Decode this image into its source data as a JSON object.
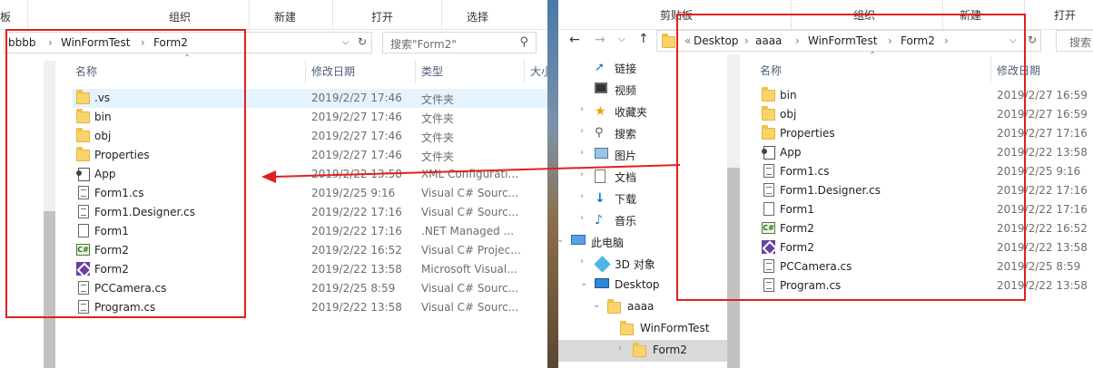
{
  "left_window": {
    "ribbon": {
      "clipboard_fragment": "板",
      "organize": "组织",
      "new": "新建",
      "open": "打开",
      "select": "选择"
    },
    "breadcrumb": [
      "bbbb",
      "WinFormTest",
      "Form2"
    ],
    "search_placeholder": "搜索\"Form2\"",
    "columns": {
      "name": "名称",
      "modified": "修改日期",
      "type": "类型",
      "size_fragment": "大小"
    },
    "files": [
      {
        "name": ".vs",
        "date": "2019/2/27 17:46",
        "type": "文件夹",
        "icon": "folder-icon"
      },
      {
        "name": "bin",
        "date": "2019/2/27 17:46",
        "type": "文件夹",
        "icon": "folder-icon"
      },
      {
        "name": "obj",
        "date": "2019/2/27 17:46",
        "type": "文件夹",
        "icon": "folder-icon"
      },
      {
        "name": "Properties",
        "date": "2019/2/27 17:46",
        "type": "文件夹",
        "icon": "folder-icon"
      },
      {
        "name": "App",
        "date": "2019/2/22 13:58",
        "type": "XML Configurati...",
        "icon": "app-config-icon"
      },
      {
        "name": "Form1.cs",
        "date": "2019/2/25 9:16",
        "type": "Visual C# Sourc...",
        "icon": "cs-file-icon"
      },
      {
        "name": "Form1.Designer.cs",
        "date": "2019/2/22 17:16",
        "type": "Visual C# Sourc...",
        "icon": "cs-file-icon"
      },
      {
        "name": "Form1",
        "date": "2019/2/22 17:16",
        "type": ".NET Managed ...",
        "icon": "resx-file-icon"
      },
      {
        "name": "Form2",
        "date": "2019/2/22 16:52",
        "type": "Visual C# Projec...",
        "icon": "csproj-icon"
      },
      {
        "name": "Form2",
        "date": "2019/2/22 13:58",
        "type": "Microsoft Visual...",
        "icon": "vs-solution-icon"
      },
      {
        "name": "PCCamera.cs",
        "date": "2019/2/25 8:59",
        "type": "Visual C# Sourc...",
        "icon": "cs-file-icon"
      },
      {
        "name": "Program.cs",
        "date": "2019/2/22 13:58",
        "type": "Visual C# Sourc...",
        "icon": "cs-file-icon"
      }
    ]
  },
  "right_window": {
    "ribbon": {
      "clipboard": "剪贴板",
      "organize": "组织",
      "new": "新建",
      "open": "打开"
    },
    "breadcrumb": [
      "Desktop",
      "aaaa",
      "WinFormTest",
      "Form2"
    ],
    "breadcrumb_overflow": "«",
    "search_fragment": "搜索",
    "columns": {
      "name": "名称",
      "modified": "修改日期"
    },
    "nav": [
      {
        "label": "链接",
        "icon": "links-icon",
        "indent": 0
      },
      {
        "label": "视频",
        "icon": "video-icon",
        "indent": 0
      },
      {
        "label": "收藏夹",
        "icon": "favorites-icon",
        "indent": 0
      },
      {
        "label": "搜索",
        "icon": "search-folder-icon",
        "indent": 0
      },
      {
        "label": "图片",
        "icon": "pictures-icon",
        "indent": 0
      },
      {
        "label": "文档",
        "icon": "documents-icon",
        "indent": 0
      },
      {
        "label": "下载",
        "icon": "downloads-icon",
        "indent": 0
      },
      {
        "label": "音乐",
        "icon": "music-icon",
        "indent": 0
      },
      {
        "label": "此电脑",
        "icon": "this-pc-icon",
        "indent": -1
      },
      {
        "label": "3D 对象",
        "icon": "3d-objects-icon",
        "indent": 0
      },
      {
        "label": "Desktop",
        "icon": "desktop-icon",
        "indent": 0
      },
      {
        "label": "aaaa",
        "icon": "folder-icon",
        "indent": 1
      },
      {
        "label": "WinFormTest",
        "icon": "folder-icon",
        "indent": 2
      },
      {
        "label": "Form2",
        "icon": "folder-icon",
        "indent": 3
      }
    ],
    "files": [
      {
        "name": "bin",
        "date": "2019/2/27 16:59",
        "icon": "folder-icon"
      },
      {
        "name": "obj",
        "date": "2019/2/27 16:59",
        "icon": "folder-icon"
      },
      {
        "name": "Properties",
        "date": "2019/2/27 17:16",
        "icon": "folder-icon"
      },
      {
        "name": "App",
        "date": "2019/2/22 13:58",
        "icon": "app-config-icon"
      },
      {
        "name": "Form1.cs",
        "date": "2019/2/25 9:16",
        "icon": "cs-file-icon"
      },
      {
        "name": "Form1.Designer.cs",
        "date": "2019/2/22 17:16",
        "icon": "cs-file-icon"
      },
      {
        "name": "Form1",
        "date": "2019/2/22 17:16",
        "icon": "resx-file-icon"
      },
      {
        "name": "Form2",
        "date": "2019/2/22 16:52",
        "icon": "csproj-icon"
      },
      {
        "name": "Form2",
        "date": "2019/2/22 13:58",
        "icon": "vs-solution-icon"
      },
      {
        "name": "PCCamera.cs",
        "date": "2019/2/25 8:59",
        "icon": "cs-file-icon"
      },
      {
        "name": "Program.cs",
        "date": "2019/2/22 13:58",
        "icon": "cs-file-icon"
      }
    ]
  },
  "colors": {
    "highlight": "#e02020",
    "selected_row": "#e5f3ff",
    "folder": "#f9d46b"
  }
}
